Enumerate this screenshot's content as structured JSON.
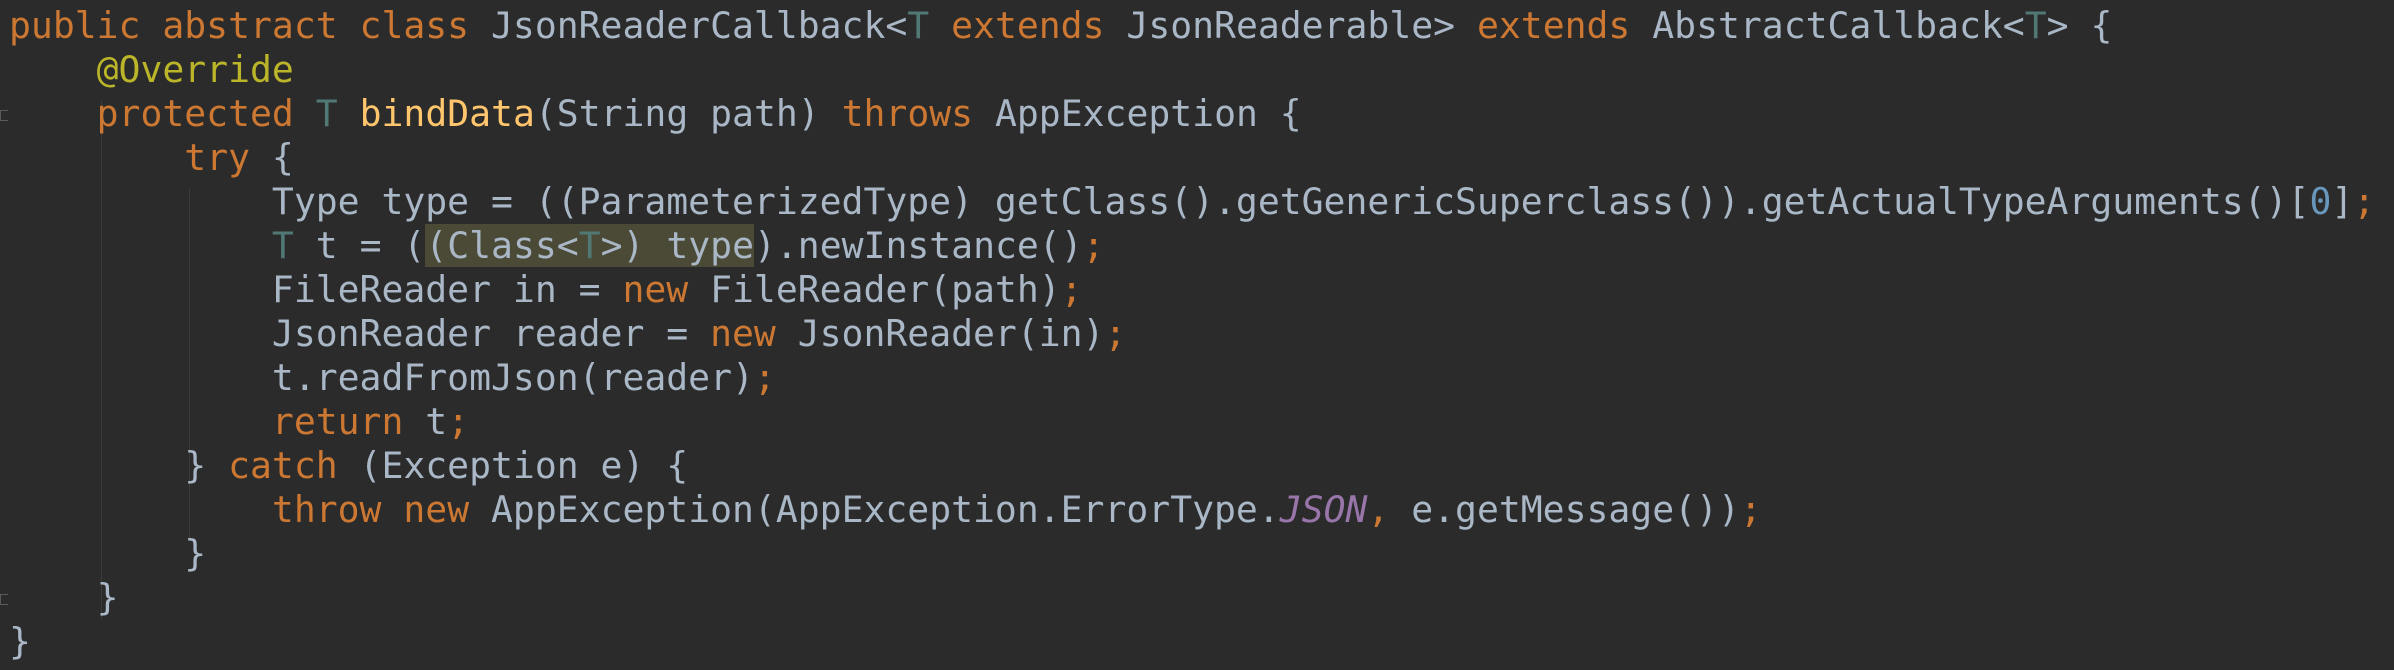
{
  "editor": {
    "theme_colors": {
      "background": "#2b2b2b",
      "keyword": "#cc7832",
      "annotation": "#bbb529",
      "type_param": "#507874",
      "method_decl": "#ffc66d",
      "number": "#6897bb",
      "constant": "#9876aa",
      "plain": "#a9b7c6",
      "highlight": "#4b4a37"
    },
    "lines": [
      {
        "tokens": [
          {
            "t": "public abstract class",
            "c": "kw"
          },
          {
            "t": " JsonReaderCallback<",
            "c": "pl"
          },
          {
            "t": "T",
            "c": "tp"
          },
          {
            "t": " ",
            "c": "pl"
          },
          {
            "t": "extends",
            "c": "kw"
          },
          {
            "t": " JsonReaderable> ",
            "c": "pl"
          },
          {
            "t": "extends",
            "c": "kw"
          },
          {
            "t": " AbstractCallback<",
            "c": "pl"
          },
          {
            "t": "T",
            "c": "tp"
          },
          {
            "t": "> {",
            "c": "pl"
          }
        ]
      },
      {
        "tokens": [
          {
            "t": "    ",
            "c": "pl"
          },
          {
            "t": "@Override",
            "c": "ann"
          }
        ]
      },
      {
        "tokens": [
          {
            "t": "    ",
            "c": "pl"
          },
          {
            "t": "protected",
            "c": "kw"
          },
          {
            "t": " ",
            "c": "pl"
          },
          {
            "t": "T",
            "c": "tp"
          },
          {
            "t": " ",
            "c": "pl"
          },
          {
            "t": "bindData",
            "c": "fn"
          },
          {
            "t": "(String path) ",
            "c": "pl"
          },
          {
            "t": "throws",
            "c": "kw"
          },
          {
            "t": " AppException {",
            "c": "pl"
          }
        ]
      },
      {
        "tokens": [
          {
            "t": "        ",
            "c": "pl"
          },
          {
            "t": "try",
            "c": "kw"
          },
          {
            "t": " {",
            "c": "pl"
          }
        ]
      },
      {
        "tokens": [
          {
            "t": "            Type type = ((ParameterizedType) getClass().getGenericSuperclass()).getActualTypeArguments()[",
            "c": "pl"
          },
          {
            "t": "0",
            "c": "num"
          },
          {
            "t": "]",
            "c": "pl"
          },
          {
            "t": ";",
            "c": "semi"
          }
        ]
      },
      {
        "tokens": [
          {
            "t": "            ",
            "c": "pl"
          },
          {
            "t": "T",
            "c": "tp"
          },
          {
            "t": " t = (",
            "c": "pl"
          },
          {
            "t": "(Class<",
            "c": "pl",
            "h": true
          },
          {
            "t": "T",
            "c": "tp",
            "h": true
          },
          {
            "t": ">) type",
            "c": "pl",
            "h": true
          },
          {
            "t": ").newInstance()",
            "c": "pl"
          },
          {
            "t": ";",
            "c": "semi"
          }
        ]
      },
      {
        "tokens": [
          {
            "t": "            FileReader in = ",
            "c": "pl"
          },
          {
            "t": "new",
            "c": "kw"
          },
          {
            "t": " FileReader(path)",
            "c": "pl"
          },
          {
            "t": ";",
            "c": "semi"
          }
        ]
      },
      {
        "tokens": [
          {
            "t": "            JsonReader reader = ",
            "c": "pl"
          },
          {
            "t": "new",
            "c": "kw"
          },
          {
            "t": " JsonReader(in)",
            "c": "pl"
          },
          {
            "t": ";",
            "c": "semi"
          }
        ]
      },
      {
        "tokens": [
          {
            "t": "            t.readFromJson(reader)",
            "c": "pl"
          },
          {
            "t": ";",
            "c": "semi"
          }
        ]
      },
      {
        "tokens": [
          {
            "t": "            ",
            "c": "pl"
          },
          {
            "t": "return",
            "c": "kw"
          },
          {
            "t": " t",
            "c": "pl"
          },
          {
            "t": ";",
            "c": "semi"
          }
        ]
      },
      {
        "tokens": [
          {
            "t": "        } ",
            "c": "pl"
          },
          {
            "t": "catch",
            "c": "kw"
          },
          {
            "t": " (Exception e) {",
            "c": "pl"
          }
        ]
      },
      {
        "tokens": [
          {
            "t": "            ",
            "c": "pl"
          },
          {
            "t": "throw new",
            "c": "kw"
          },
          {
            "t": " AppException(AppException.ErrorType.",
            "c": "pl"
          },
          {
            "t": "JSON",
            "c": "cst"
          },
          {
            "t": ", ",
            "c": "kw"
          },
          {
            "t": "e.getMessage())",
            "c": "pl"
          },
          {
            "t": ";",
            "c": "semi"
          }
        ]
      },
      {
        "tokens": [
          {
            "t": "        }",
            "c": "pl"
          }
        ]
      },
      {
        "tokens": [
          {
            "t": "    }",
            "c": "pl"
          }
        ]
      },
      {
        "tokens": [
          {
            "t": "}",
            "c": "pl"
          }
        ]
      }
    ]
  }
}
